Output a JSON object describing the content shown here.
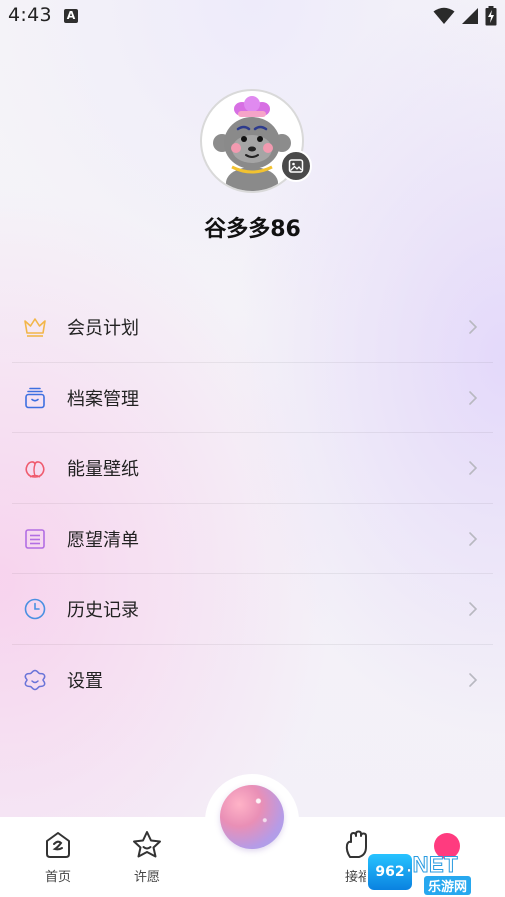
{
  "status_bar": {
    "time": "4:43",
    "notification_icon": "a-box-icon",
    "right_icons": [
      "wifi-icon",
      "cellular-signal-icon",
      "battery-charging-icon"
    ]
  },
  "profile": {
    "avatar_icon": "monkey-avatar-icon",
    "edit_avatar_icon": "image-icon",
    "username": "谷多多86"
  },
  "menu": {
    "items": [
      {
        "label": "会员计划",
        "icon": "crown-icon",
        "color": "#f2b64a"
      },
      {
        "label": "档案管理",
        "icon": "archive-box-icon",
        "color": "#3d6fe0"
      },
      {
        "label": "能量壁纸",
        "icon": "peach-icon",
        "color": "#ef5b6e"
      },
      {
        "label": "愿望清单",
        "icon": "list-icon",
        "color": "#b36ee3"
      },
      {
        "label": "历史记录",
        "icon": "clock-icon",
        "color": "#4a90e2"
      },
      {
        "label": "设置",
        "icon": "settings-flower-icon",
        "color": "#6a74d8"
      }
    ],
    "chevron_icon": "chevron-right-icon"
  },
  "bottom_nav": {
    "items": [
      {
        "label": "首页",
        "icon": "home-icon"
      },
      {
        "label": "许愿",
        "icon": "star-icon"
      },
      {
        "label": "接福",
        "icon": "hand-icon"
      }
    ],
    "center_icon": "orb-icon",
    "badge_color": "#ff3b7f"
  },
  "watermark": {
    "badge": "962",
    "top_text": ".NET",
    "bottom_text": "乐游网"
  }
}
